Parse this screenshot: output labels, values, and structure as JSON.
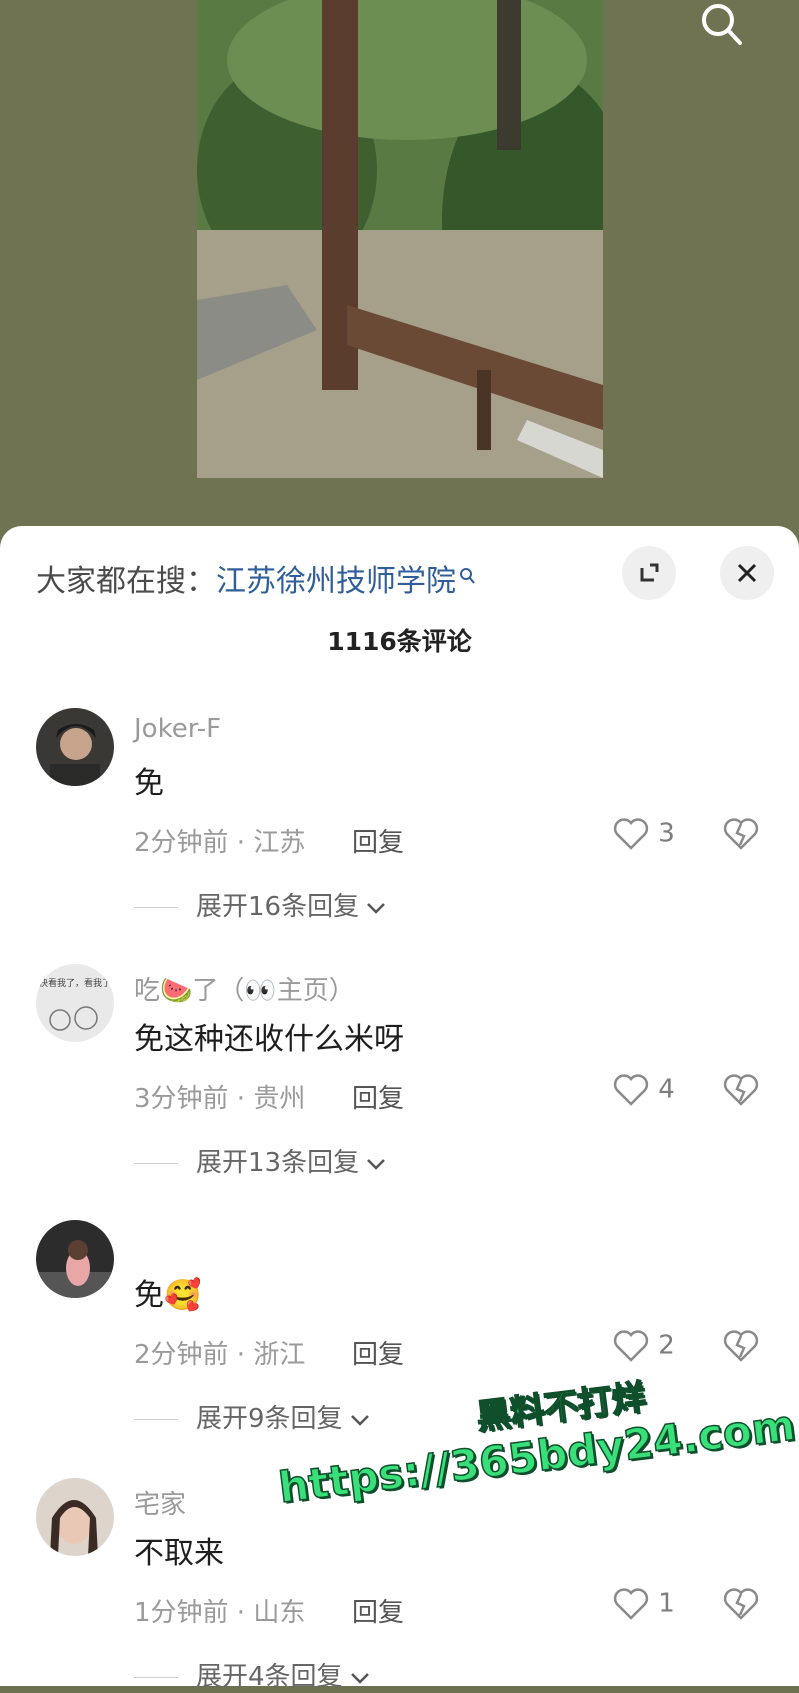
{
  "search_bar": {
    "prefix": "大家都在搜：",
    "link": "江苏徐州技师学院"
  },
  "comment_count": "1116条评论",
  "comments": [
    {
      "user": "Joker-F",
      "text": "免",
      "time": "2分钟前 · 江苏",
      "reply": "回复",
      "likes": "3",
      "expand": "展开16条回复"
    },
    {
      "user": "吃🍉了（👀主页）",
      "text": "免这种还收什么米呀",
      "time": "3分钟前 · 贵州",
      "reply": "回复",
      "likes": "4",
      "expand": "展开13条回复"
    },
    {
      "user": "",
      "text": "免🥰",
      "time": "2分钟前 · 浙江",
      "reply": "回复",
      "likes": "2",
      "expand": "展开9条回复"
    },
    {
      "user": "宅家",
      "text": "不取来",
      "time": "1分钟前 · 山东",
      "reply": "回复",
      "likes": "1",
      "expand": "展开4条回复"
    }
  ],
  "avatar2_text": "快看我了，看我了",
  "watermark": {
    "line1": "黑料不打烊",
    "line2": "https://365bdy24.com"
  },
  "colors": {
    "background": "#6f7352",
    "link": "#2f5e9a",
    "watermark": "#39e07a"
  }
}
